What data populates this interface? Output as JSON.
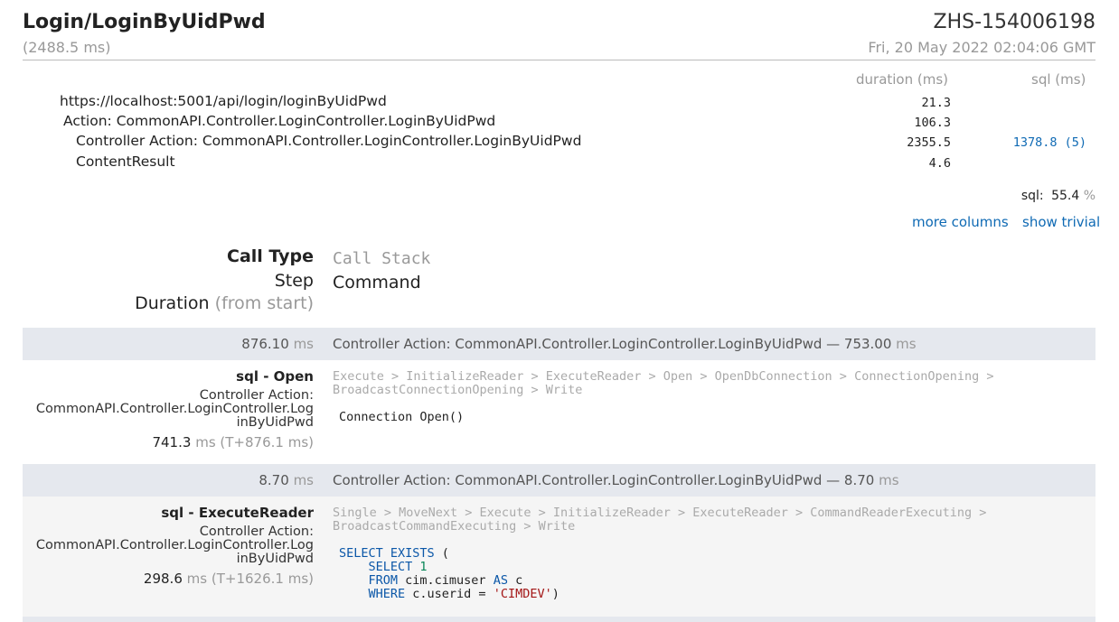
{
  "header": {
    "title": "Login/LoginByUidPwd",
    "total_duration": "(2488.5 ms)",
    "machine": "ZHS-154006198",
    "started": "Fri, 20 May 2022 02:04:06 GMT"
  },
  "timings": {
    "col_duration": "duration (ms)",
    "col_sql": "sql (ms)",
    "rows": [
      {
        "name": "https://localhost:5001/api/login/loginByUidPwd",
        "duration": "21.3",
        "sql": ""
      },
      {
        "name": "Action: CommonAPI.Controller.LoginController.LoginByUidPwd",
        "duration": "106.3",
        "sql": ""
      },
      {
        "name": "Controller Action: CommonAPI.Controller.LoginController.LoginByUidPwd",
        "duration": "2355.5",
        "sql": "1378.8 (5)"
      },
      {
        "name": "ContentResult",
        "duration": "4.6",
        "sql": ""
      }
    ],
    "sql_label": "sql:",
    "sql_value": "55.4",
    "sql_unit": "%",
    "more_columns": "more columns",
    "show_trivial": "show trivial"
  },
  "queries_header": {
    "call_type": "Call Type",
    "call_stack": "Call Stack",
    "step": "Step",
    "command": "Command",
    "duration": "Duration",
    "from_start": "(from start)"
  },
  "groups": [
    {
      "band_time": "876.10",
      "band_unit": "ms",
      "band_title": "Controller Action: CommonAPI.Controller.LoginController.LoginByUidPwd — 753.00",
      "band_title_unit": "ms",
      "type": "sql - Open",
      "step_line1": "Controller Action:",
      "step_line2": "CommonAPI.Controller.LoginController.Log",
      "step_line3": "inByUidPwd",
      "duration": "741.3",
      "duration_unit": "ms",
      "from_start": "(T+876.1 ms)",
      "stack_line1": "Execute > InitializeReader > ExecuteReader > Open > OpenDbConnection > ConnectionOpening >",
      "stack_line2": "BroadcastConnectionOpening > Write",
      "command": "Connection Open()"
    },
    {
      "band_time": "8.70",
      "band_unit": "ms",
      "band_title": "Controller Action: CommonAPI.Controller.LoginController.LoginByUidPwd — 8.70",
      "band_title_unit": "ms",
      "type": "sql - ExecuteReader",
      "step_line1": "Controller Action:",
      "step_line2": "CommonAPI.Controller.LoginController.Log",
      "step_line3": "inByUidPwd",
      "duration": "298.6",
      "duration_unit": "ms",
      "from_start": "(T+1626.1 ms)",
      "stack_line1": "Single > MoveNext > Execute > InitializeReader > ExecuteReader > CommandReaderExecuting >",
      "stack_line2": "BroadcastCommandExecuting > Write",
      "sql": {
        "l1_kw": "SELECT EXISTS",
        "l1_rest": " (",
        "l2_kw": "SELECT",
        "l2_num": " 1",
        "l3_kw": "FROM",
        "l3_rest": " cim.cimuser ",
        "l3_kw2": "AS",
        "l3_rest2": " c",
        "l4_kw": "WHERE",
        "l4_rest": " c.userid = ",
        "l4_str": "'CIMDEV'",
        "l4_end": ")"
      }
    }
  ]
}
